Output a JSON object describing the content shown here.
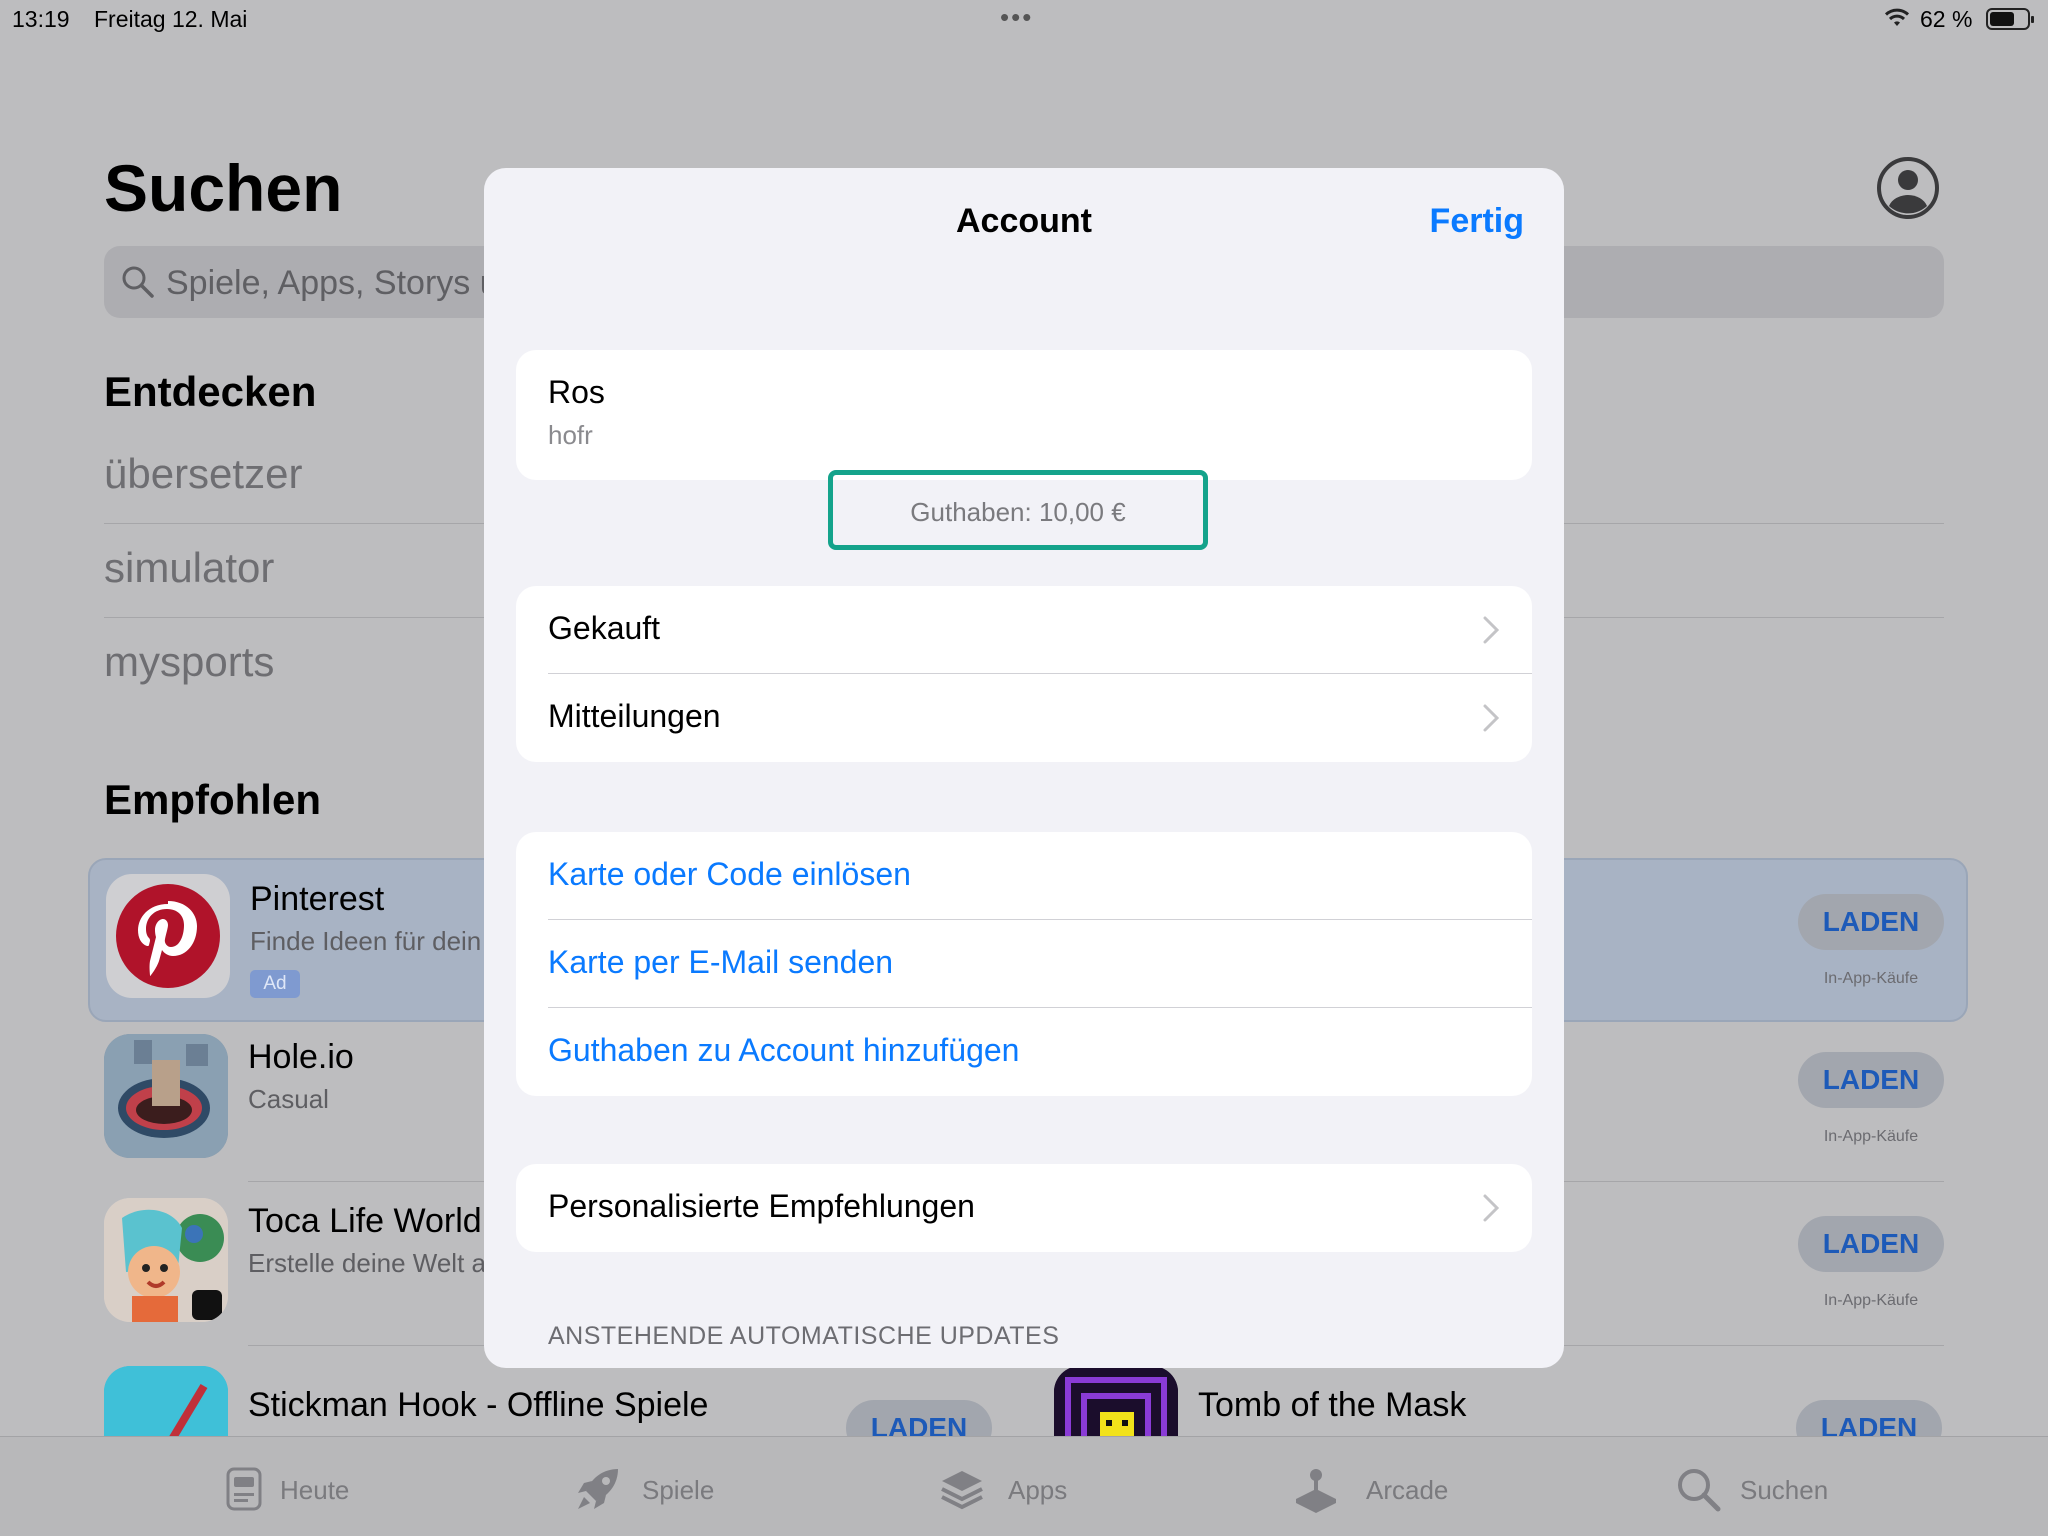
{
  "status_bar": {
    "time": "13:19",
    "date": "Freitag 12. Mai",
    "dots": "•••",
    "battery_pct": "62 %"
  },
  "page": {
    "title": "Suchen",
    "search_placeholder": "Spiele, Apps, Storys u",
    "discover_heading": "Entdecken",
    "recent_searches": [
      "übersetzer",
      "simulator",
      "mysports"
    ],
    "recommended_heading": "Empfohlen"
  },
  "apps": [
    {
      "name": "Pinterest",
      "subtitle": "Finde Ideen für dein",
      "badge": "Ad",
      "button": "LADEN",
      "note": "In-App-Käufe"
    },
    {
      "name": "Hole.io",
      "subtitle": "Casual",
      "button": "LADEN",
      "note": "In-App-Käufe"
    },
    {
      "name": "Toca Life World",
      "subtitle": "Erstelle deine Welt a",
      "button": "LADEN",
      "note": "In-App-Käufe"
    }
  ],
  "bottom_row": {
    "left_app": {
      "name": "Stickman Hook - Offline Spiele",
      "button": "LADEN"
    },
    "right_app": {
      "name": "Tomb of the Mask",
      "button": "LADEN"
    }
  },
  "tabs": [
    {
      "label": "Heute",
      "icon": "today-icon"
    },
    {
      "label": "Spiele",
      "icon": "rocket-icon"
    },
    {
      "label": "Apps",
      "icon": "apps-stack-icon"
    },
    {
      "label": "Arcade",
      "icon": "joystick-icon"
    },
    {
      "label": "Suchen",
      "icon": "search-icon"
    }
  ],
  "modal": {
    "title": "Account",
    "done": "Fertig",
    "account_name": "Ros",
    "account_email": "hofr",
    "balance": "Guthaben: 10,00 €",
    "group1": [
      "Gekauft",
      "Mitteilungen"
    ],
    "group2": [
      "Karte oder Code einlösen",
      "Karte per E-Mail senden",
      "Guthaben zu Account hinzufügen"
    ],
    "group3": [
      "Personalisierte Empfehlungen"
    ],
    "section_header": "ANSTEHENDE AUTOMATISCHE UPDATES"
  },
  "colors": {
    "link": "#0a7aff",
    "highlight": "#14a38b",
    "dim_bg": "#bdbdbf"
  }
}
